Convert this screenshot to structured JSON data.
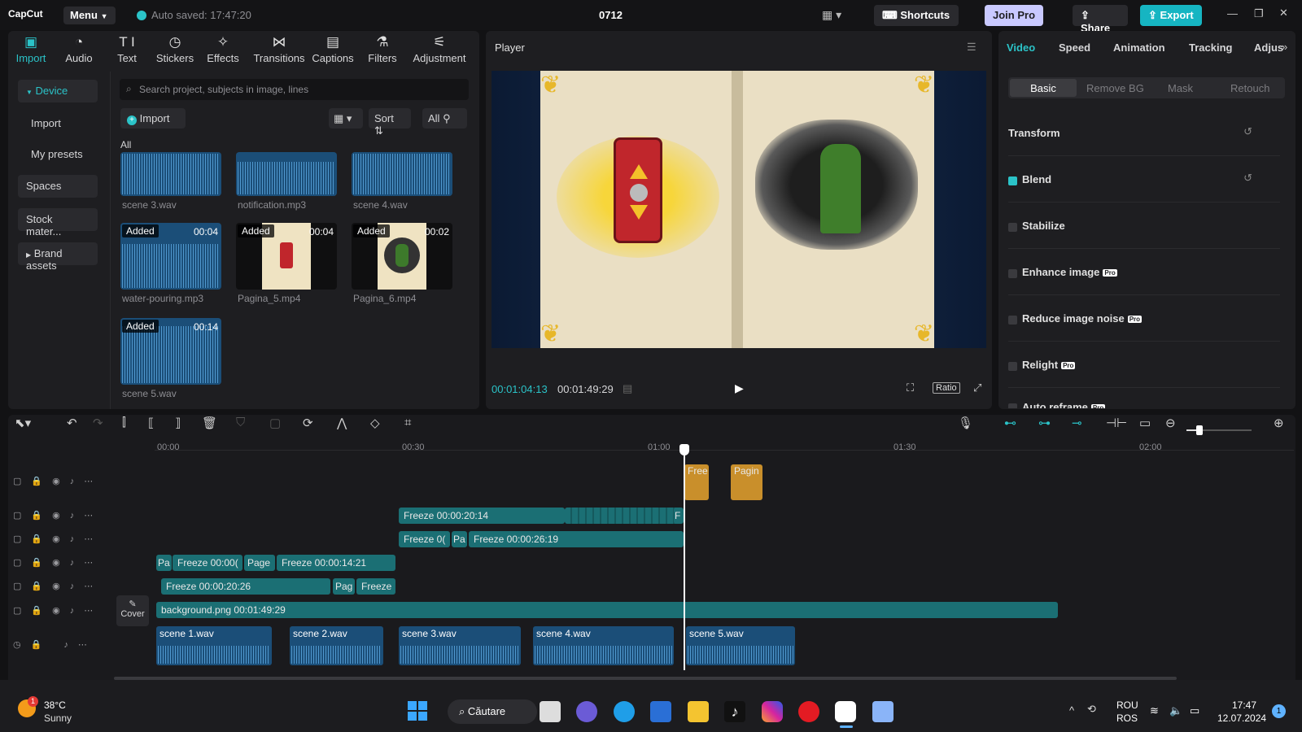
{
  "titlebar": {
    "logo": "CapCut",
    "menu_label": "Menu",
    "autosave": "Auto saved: 17:47:20",
    "project_name": "0712",
    "shortcuts_label": "Shortcuts",
    "join_pro_label": "Join Pro",
    "share_label": "Share",
    "export_label": "Export"
  },
  "toolbar_tabs": [
    {
      "label": "Import",
      "icon": "import-icon"
    },
    {
      "label": "Audio",
      "icon": "audio-icon"
    },
    {
      "label": "Text",
      "icon": "text-icon"
    },
    {
      "label": "Stickers",
      "icon": "stickers-icon"
    },
    {
      "label": "Effects",
      "icon": "effects-icon"
    },
    {
      "label": "Transitions",
      "icon": "transitions-icon"
    },
    {
      "label": "Captions",
      "icon": "captions-icon"
    },
    {
      "label": "Filters",
      "icon": "filters-icon"
    },
    {
      "label": "Adjustment",
      "icon": "adjustment-icon"
    }
  ],
  "sidebar": {
    "items": [
      "Device",
      "Import",
      "My presets",
      "Spaces",
      "Stock mater...",
      "Brand assets"
    ]
  },
  "media": {
    "search_placeholder": "Search project, subjects in image, lines",
    "import_label": "Import",
    "sort_label": "Sort",
    "all_filter": "All",
    "section_label": "All",
    "added_label": "Added",
    "items": [
      {
        "name": "scene 3.wav",
        "duration": ""
      },
      {
        "name": "notification.mp3",
        "duration": ""
      },
      {
        "name": "scene 4.wav",
        "duration": ""
      },
      {
        "name": "water-pouring.mp3",
        "duration": "00:04"
      },
      {
        "name": "Pagina_5.mp4",
        "duration": "00:04"
      },
      {
        "name": "Pagina_6.mp4",
        "duration": "00:02"
      },
      {
        "name": "scene 5.wav",
        "duration": "00:14"
      }
    ]
  },
  "player": {
    "title": "Player",
    "current_time": "00:01:04:13",
    "total_time": "00:01:49:29",
    "ratio_label": "Ratio"
  },
  "properties": {
    "tabs": [
      "Video",
      "Speed",
      "Animation",
      "Tracking",
      "Adjus"
    ],
    "subtabs": [
      "Basic",
      "Remove BG",
      "Mask",
      "Retouch"
    ],
    "rows": [
      "Transform",
      "Blend",
      "Stabilize",
      "Enhance image",
      "Reduce image noise",
      "Relight",
      "Auto reframe"
    ],
    "pro_badge": "Pro"
  },
  "timeline": {
    "ruler": [
      "00:00",
      "00:30",
      "01:00",
      "01:30",
      "02:00"
    ],
    "cover_label": "Cover",
    "clips": {
      "top1": "Free",
      "top2": "Pagin",
      "r1a": "Freeze  00:00:20:14",
      "r1b": "F",
      "r2a": "Freeze  0(",
      "r2b": "Pa",
      "r2c": "Freeze  00:00:26:19",
      "r3a": "Pa",
      "r3b": "Freeze  00:00(",
      "r3c": "Page",
      "r3d": "Freeze  00:00:14:21",
      "r4a": "Freeze  00:00:20:26",
      "r4b": "Pag",
      "r4c": "Freeze",
      "bg": "background.png  00:01:49:29",
      "a1": "scene 1.wav",
      "a2": "scene 2.wav",
      "a3": "scene 3.wav",
      "a4": "scene 4.wav",
      "a5": "scene 5.wav"
    }
  },
  "taskbar": {
    "temp": "38°C",
    "weather": "Sunny",
    "search_label": "Căutare",
    "lang1": "ROU",
    "lang2": "ROS",
    "time": "17:47",
    "date": "12.07.2024",
    "notif_count": "1",
    "weather_badge": "1"
  },
  "colors": {
    "accent": "#2bc3c8",
    "video_clip": "#1b6f74",
    "audio_clip": "#1b4e78",
    "join_pro": "#c9c9ff",
    "export": "#16b5c2"
  }
}
